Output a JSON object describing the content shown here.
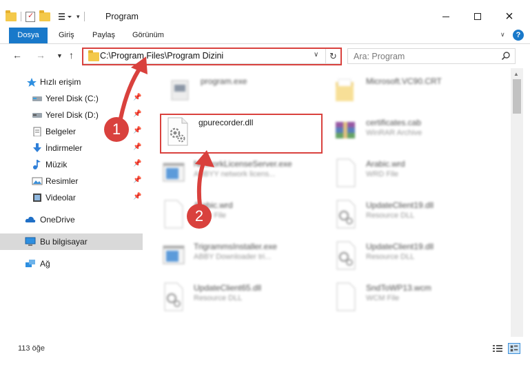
{
  "window": {
    "title": "Program",
    "controls": {
      "minimize": "minimize",
      "maximize": "maximize",
      "close": "×"
    }
  },
  "ribbon": {
    "tabs": [
      "Dosya",
      "Giriş",
      "Paylaş",
      "Görünüm"
    ],
    "help": "?"
  },
  "address": {
    "path": "C:\\Program Files\\Program Dizini",
    "search_placeholder": "Ara: Program"
  },
  "nav": {
    "quick_access": "Hızlı erişim",
    "items": [
      {
        "label": "Yerel Disk (C:)",
        "icon": "drive-icon",
        "pinned": true
      },
      {
        "label": "Yerel Disk (D:)",
        "icon": "drive-icon",
        "pinned": true
      },
      {
        "label": "Belgeler",
        "icon": "documents-icon",
        "pinned": true
      },
      {
        "label": "İndirmeler",
        "icon": "downloads-icon",
        "pinned": true
      },
      {
        "label": "Müzik",
        "icon": "music-icon",
        "pinned": true
      },
      {
        "label": "Resimler",
        "icon": "pictures-icon",
        "pinned": true
      },
      {
        "label": "Videolar",
        "icon": "videos-icon",
        "pinned": true
      }
    ],
    "onedrive": "OneDrive",
    "this_pc": "Bu bilgisayar",
    "network": "Ağ"
  },
  "files": [
    {
      "name": "program.exe",
      "type": "",
      "icon": "exe-icon",
      "blurred": true
    },
    {
      "name": "Microsoft.VC90.CRT",
      "type": "",
      "icon": "folder-icon",
      "blurred": true
    },
    {
      "name": "gpurecorder.dll",
      "type": "",
      "icon": "dll-icon",
      "blurred": false
    },
    {
      "name": "certificates.cab",
      "type": "WinRAR Archive",
      "icon": "archive-icon",
      "blurred": true
    },
    {
      "name": "NetworkLicenseServer.exe",
      "type": "ABBYY network licens...",
      "icon": "exe-window-icon",
      "blurred": true
    },
    {
      "name": "Arabic.wrd",
      "type": "WRD File",
      "icon": "file-icon",
      "blurred": true
    },
    {
      "name": "Arabic.wrd",
      "type": "WRD File",
      "icon": "file-icon",
      "blurred": true
    },
    {
      "name": "UpdateClient19.dll",
      "type": "Resource DLL",
      "icon": "dll-icon",
      "blurred": true
    },
    {
      "name": "TrigrammsInstaller.exe",
      "type": "ABBY Downloader tri...",
      "icon": "exe-window-icon",
      "blurred": true
    },
    {
      "name": "UpdateClient19.dll",
      "type": "Resource DLL",
      "icon": "dll-icon",
      "blurred": true
    },
    {
      "name": "UpdateClient65.dll",
      "type": "Resource DLL",
      "icon": "dll-icon",
      "blurred": true
    },
    {
      "name": "SndToWP13.wcm",
      "type": "WCM File",
      "icon": "file-icon",
      "blurred": true
    }
  ],
  "annotations": {
    "step1": "1",
    "step2": "2"
  },
  "status": {
    "count": "113 öğe"
  },
  "colors": {
    "accent": "#1979ca",
    "highlight": "#d9413d",
    "selected_nav": "#d9d9d9"
  }
}
